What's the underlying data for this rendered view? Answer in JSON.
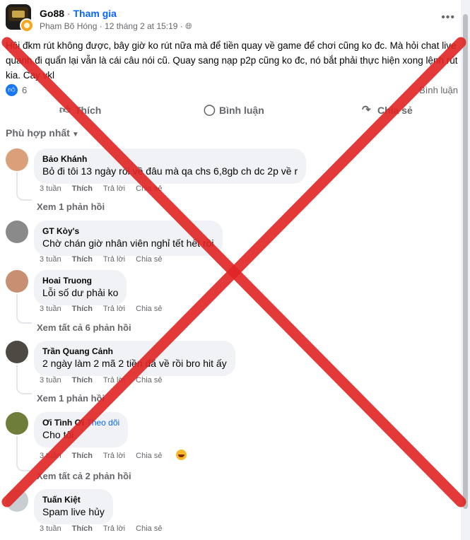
{
  "header": {
    "group_name": "Go88",
    "separator": "·",
    "join_label": "Tham gia",
    "meta": "Phạm Bõ Hóng · 12 tháng 2 at 15:19 ·",
    "more_icon": "more-horizontal-icon"
  },
  "post": {
    "text": "Hôi đkm rút không được, bây giờ ko rút nữa mà để tiền quay về game để chơi cũng ko đc. Mà hỏi chat live quanh đi quẩn lại vẫn là cái câu nói cũ. Quay sang nạp p2p cũng ko đc, nó bắt phải thực hiện xong lệnh rút kia. Cay vkl",
    "reaction_count": "6",
    "comment_count_label": "Bình luận"
  },
  "actions": {
    "like": "Thích",
    "comment": "Bình luận",
    "share": "Chia sẻ"
  },
  "sort_label": "Phù hợp nhất",
  "comments": [
    {
      "name": "Bảo Khánh",
      "text": "Bỏ đi tôi 13 ngày rồi về đâu mà qa chs 6,8gb ch dc 2p về r",
      "time": "3 tuần",
      "like": "Thích",
      "reply": "Trả lời",
      "share": "Chia sẻ",
      "replies": "Xem 1 phản hồi",
      "avatar_color": "#d9a07a"
    },
    {
      "name": "GT Kòy's",
      "text": "Chờ chán giờ nhân viên nghỉ tết hết rồi",
      "time": "3 tuần",
      "like": "Thích",
      "reply": "Trả lời",
      "share": "Chia sẻ",
      "avatar_color": "#8a8a8a"
    },
    {
      "name": "Hoai Truong",
      "text": "Lỗi số dư phải ko",
      "time": "3 tuần",
      "like": "Thích",
      "reply": "Trả lời",
      "share": "Chia sẻ",
      "replies": "Xem tất cả 6 phản hồi",
      "avatar_color": "#c98f72"
    },
    {
      "name": "Trần Quang Cảnh",
      "text": "2 ngày làm 2 mã 2 tiền đã về rồi bro hit ấy",
      "time": "3 tuần",
      "like": "Thích",
      "reply": "Trả lời",
      "share": "Chia sẻ",
      "replies": "Xem 1 phản hồi",
      "avatar_color": "#4d4a44"
    },
    {
      "name": "Ơi Tình Ơi",
      "follow": "Theo dõi",
      "text": "Cho tôi",
      "time": "3 tuần",
      "like": "Thích",
      "reply": "Trả lời",
      "share": "Chia sẻ",
      "replies": "Xem tất cả 2 phản hồi",
      "avatar_color": "#6f7d3a"
    },
    {
      "name": "Tuấn Kiệt",
      "text": "Spam live hủy",
      "time": "3 tuần",
      "like": "Thích",
      "reply": "Trả lời",
      "share": "Chia sẻ",
      "avatar_color": "#c9ccd1"
    }
  ],
  "overlay": {
    "mark": "red-x-mark",
    "color": "#e02424"
  }
}
